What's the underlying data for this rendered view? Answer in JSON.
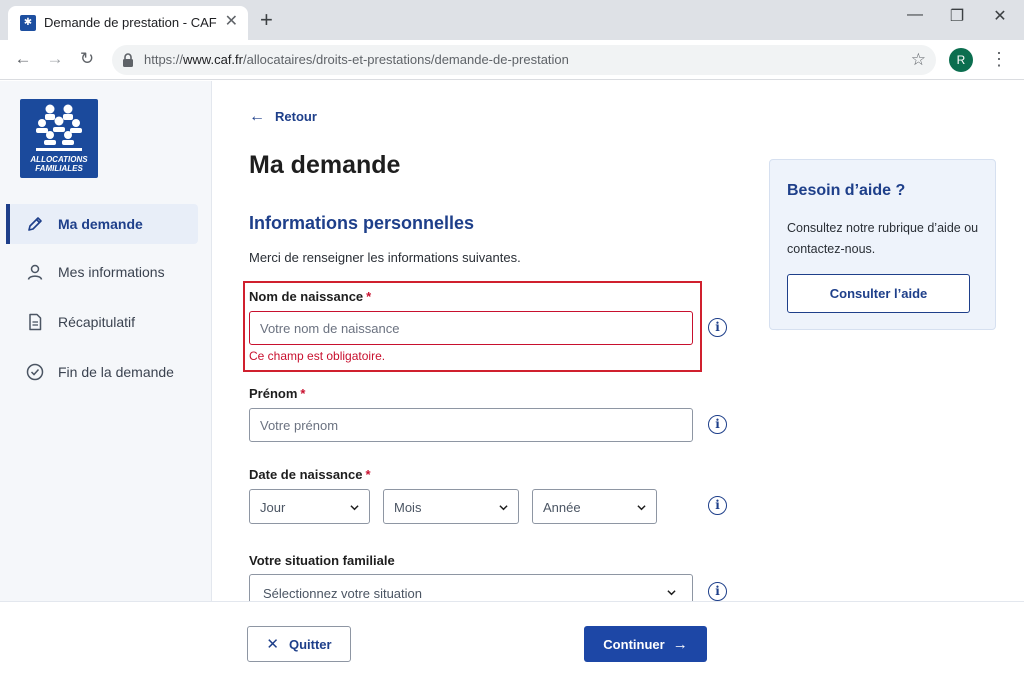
{
  "browser": {
    "tab_title": "Demande de prestation - CAF",
    "url_scheme": "https://",
    "url_host": "www.caf.fr",
    "url_path": "/allocataires/droits-et-prestations/demande-de-prestation",
    "profile_initial": "R"
  },
  "sidebar": {
    "logo_line1": "ALLOCATIONS",
    "logo_line2": "FAMILIALES",
    "items": [
      {
        "label": "Ma demande",
        "icon": "pencil-icon",
        "active": true
      },
      {
        "label": "Mes informations",
        "icon": "user-icon",
        "active": false
      },
      {
        "label": "Récapitulatif",
        "icon": "document-icon",
        "active": false
      },
      {
        "label": "Fin de la demande",
        "icon": "check-circle-icon",
        "active": false
      }
    ]
  },
  "main": {
    "back_label": "Retour",
    "title": "Ma demande",
    "section_title": "Informations personnelles",
    "intro": "Merci de renseigner les informations suivantes.",
    "fields": {
      "nom": {
        "label": "Nom de naissance",
        "required": "*",
        "placeholder": "Votre nom de naissance",
        "value": "",
        "error": "Ce champ est obligatoire."
      },
      "prenom": {
        "label": "Prénom",
        "required": "*",
        "placeholder": "Votre prénom",
        "value": ""
      },
      "date": {
        "label": "Date de naissance",
        "required": "*",
        "day": "Jour",
        "month": "Mois",
        "year": "Année"
      },
      "situation": {
        "label": "Votre situation familiale",
        "selected": "Sélectionnez votre situation"
      }
    }
  },
  "help": {
    "title": "Besoin d’aide ?",
    "text": "Consultez notre rubrique d’aide ou contactez-nous.",
    "button": "Consulter l’aide"
  },
  "footer": {
    "quit_label": "Quitter",
    "continue_label": "Continuer"
  },
  "colors": {
    "primary": "#1e3f8a",
    "error": "#c8102e",
    "button_primary": "#1d47a6"
  }
}
